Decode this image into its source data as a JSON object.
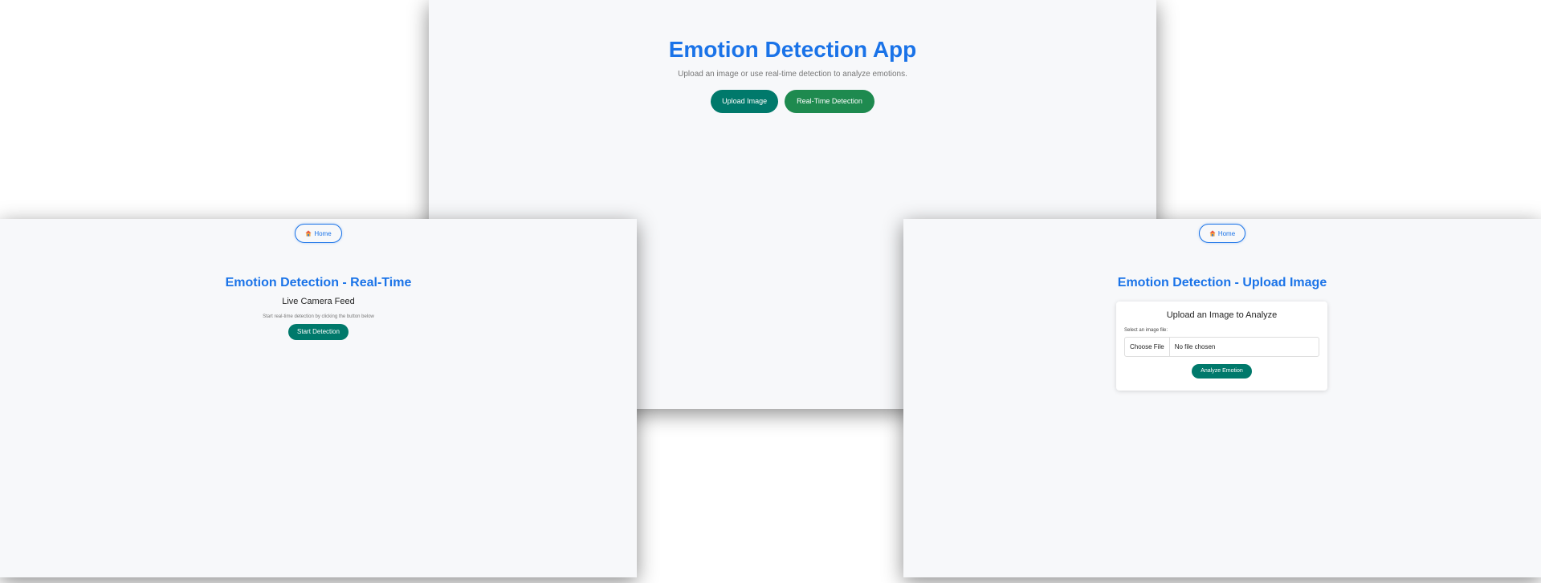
{
  "home": {
    "title": "Emotion Detection App",
    "subtitle": "Upload an image or use real-time detection to analyze emotions.",
    "upload_button": "Upload Image",
    "realtime_button": "Real-Time Detection"
  },
  "realtime": {
    "home_button": "Home",
    "home_icon": "house-icon",
    "title": "Emotion Detection - Real-Time",
    "feed_title": "Live Camera Feed",
    "hint": "Start real-time detection by clicking the button below",
    "start_button": "Start Detection"
  },
  "upload": {
    "home_button": "Home",
    "home_icon": "house-icon",
    "title": "Emotion Detection - Upload Image",
    "card_title": "Upload an Image to Analyze",
    "file_label": "Select an image file:",
    "choose_file": "Choose File",
    "file_status": "No file chosen",
    "analyze_button": "Analyze Emotion"
  },
  "colors": {
    "accent": "#1a73e8",
    "primary_button": "#00796b",
    "realtime_button": "#1e8a4f",
    "panel_background": "#f7f8fa"
  }
}
